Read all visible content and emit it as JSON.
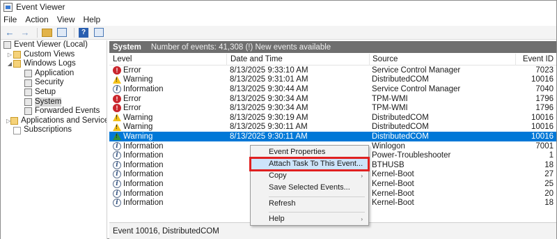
{
  "window": {
    "title": "Event Viewer",
    "title_icon": "event-viewer-icon"
  },
  "menu": [
    "File",
    "Action",
    "View",
    "Help"
  ],
  "toolbar": {
    "buttons": [
      "back-arrow-icon",
      "forward-arrow-icon",
      "up-folder-icon",
      "show-hide-tree-icon",
      "help-icon",
      "properties-icon"
    ],
    "help_glyph": "?"
  },
  "tree": {
    "root": "Event Viewer (Local)",
    "custom_views": "Custom Views",
    "windows_logs": "Windows Logs",
    "logs": [
      "Application",
      "Security",
      "Setup",
      "System",
      "Forwarded Events"
    ],
    "selected_log": "System",
    "apps_services": "Applications and Services Log",
    "subscriptions": "Subscriptions"
  },
  "pane": {
    "title": "System",
    "info": "Number of events: 41,308 (!) New events available"
  },
  "grid": {
    "columns": [
      "Level",
      "Date and Time",
      "Source",
      "Event ID"
    ],
    "rows": [
      {
        "level": "Error",
        "icon": "error",
        "date": "8/13/2025 9:33:10 AM",
        "source": "Service Control Manager",
        "id": "7023"
      },
      {
        "level": "Warning",
        "icon": "warning",
        "date": "8/13/2025 9:31:01 AM",
        "source": "DistributedCOM",
        "id": "10016"
      },
      {
        "level": "Information",
        "icon": "info",
        "date": "8/13/2025 9:30:44 AM",
        "source": "Service Control Manager",
        "id": "7040"
      },
      {
        "level": "Error",
        "icon": "error",
        "date": "8/13/2025 9:30:34 AM",
        "source": "TPM-WMI",
        "id": "1796"
      },
      {
        "level": "Error",
        "icon": "error",
        "date": "8/13/2025 9:30:34 AM",
        "source": "TPM-WMI",
        "id": "1796"
      },
      {
        "level": "Warning",
        "icon": "warning",
        "date": "8/13/2025 9:30:19 AM",
        "source": "DistributedCOM",
        "id": "10016"
      },
      {
        "level": "Warning",
        "icon": "warning",
        "date": "8/13/2025 9:30:11 AM",
        "source": "DistributedCOM",
        "id": "10016"
      },
      {
        "level": "Warning",
        "icon": "warning",
        "date": "8/13/2025 9:30:11 AM",
        "source": "DistributedCOM",
        "id": "10016",
        "selected": true
      },
      {
        "level": "Information",
        "icon": "info",
        "date": "",
        "source": "Winlogon",
        "id": "7001"
      },
      {
        "level": "Information",
        "icon": "info",
        "date": "",
        "source": "Power-Troubleshooter",
        "id": "1"
      },
      {
        "level": "Information",
        "icon": "info",
        "date": "",
        "source": "BTHUSB",
        "id": "18"
      },
      {
        "level": "Information",
        "icon": "info",
        "date": "",
        "source": "Kernel-Boot",
        "id": "27"
      },
      {
        "level": "Information",
        "icon": "info",
        "date": "",
        "source": "Kernel-Boot",
        "id": "25"
      },
      {
        "level": "Information",
        "icon": "info",
        "date": "",
        "source": "Kernel-Boot",
        "id": "20"
      },
      {
        "level": "Information",
        "icon": "info",
        "date": "",
        "source": "Kernel-Boot",
        "id": "18"
      }
    ]
  },
  "status": "Event 10016, DistributedCOM",
  "context_menu": {
    "items": [
      "Event Properties",
      "Attach Task To This Event...",
      "Copy",
      "Save Selected Events...",
      "Refresh",
      "Help"
    ],
    "highlighted": "Attach Task To This Event...",
    "highlight_color": "#e02020",
    "submenu_glyph": "›"
  },
  "colors": {
    "selection": "#0078d7",
    "header": "#6f6f6f",
    "error": "#c9252c",
    "warning": "#f3c11a"
  }
}
